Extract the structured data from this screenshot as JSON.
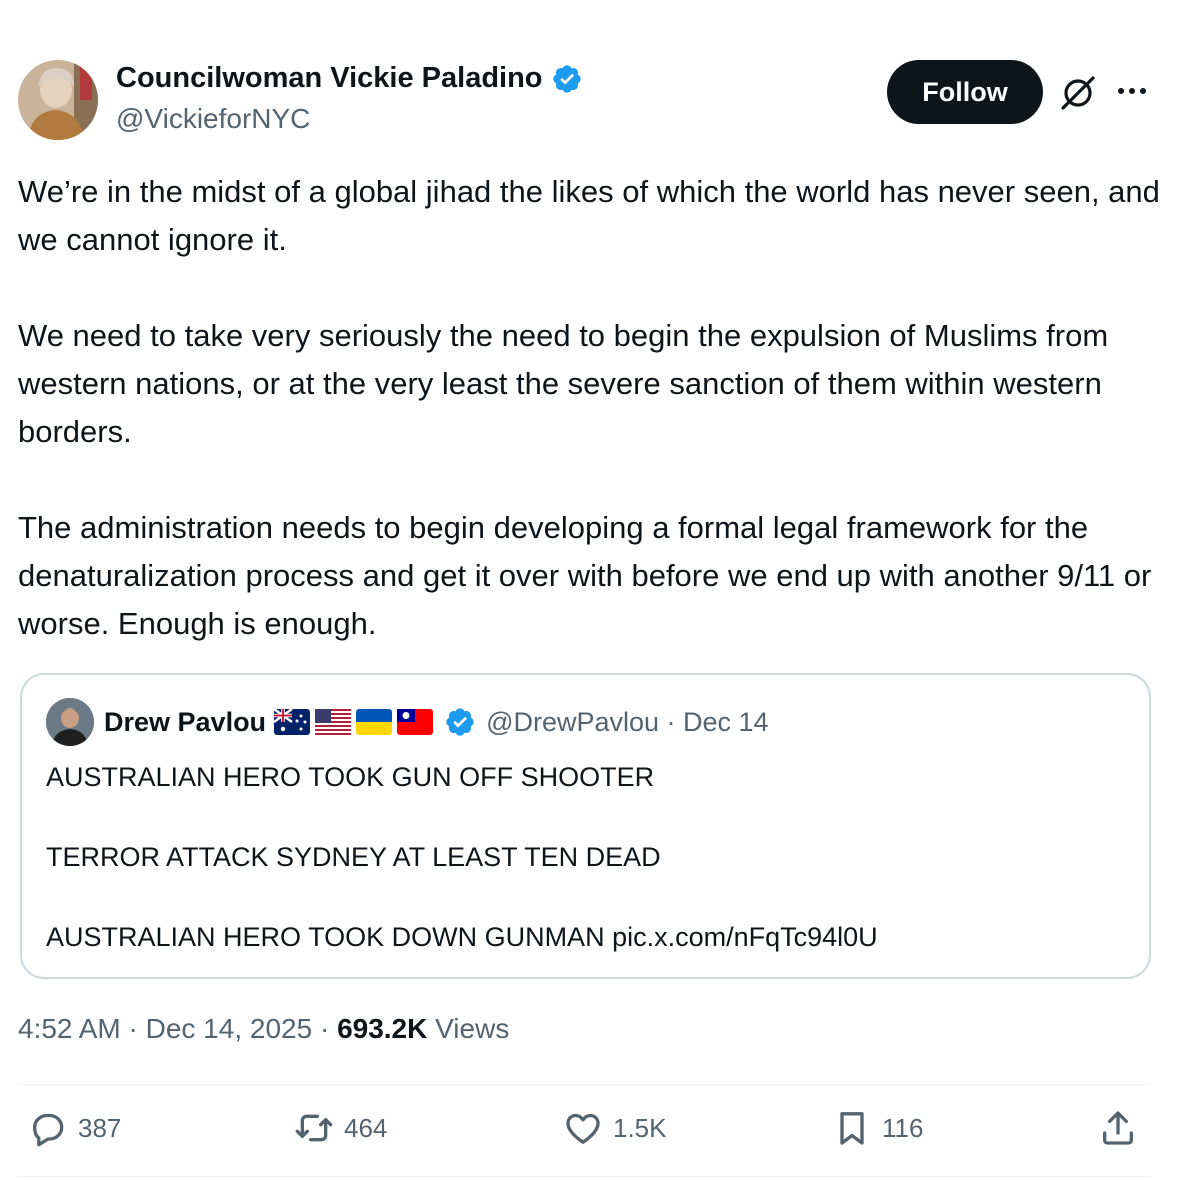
{
  "author": {
    "name": "Councilwoman Vickie Paladino",
    "handle": "@VickieforNYC"
  },
  "header": {
    "follow_label": "Follow"
  },
  "post": {
    "paragraphs": [
      "We’re in the midst of a global jihad the likes of which the world has never seen, and we cannot ignore it.",
      "We need to take very seriously the need to begin the expulsion of Muslims from western nations, or at the very least the severe sanction of them within western borders.",
      "The administration needs to begin developing a formal legal framework for the denaturalization process and get it over with before we end up with another 9/11 or worse. Enough is enough."
    ]
  },
  "quote": {
    "name": "Drew Pavlou",
    "flags": [
      "australia-flag",
      "usa-flag",
      "ukraine-flag",
      "taiwan-flag"
    ],
    "handle_date": "@DrewPavlou · Dec 14",
    "lines": [
      "AUSTRALIAN HERO TOOK GUN OFF SHOOTER",
      "TERROR ATTACK SYDNEY AT LEAST TEN DEAD",
      "AUSTRALIAN HERO TOOK DOWN GUNMAN pic.x.com/nFqTc94l0U"
    ]
  },
  "meta": {
    "timestamp": "4:52 AM · Dec 14, 2025 · ",
    "views_count": "693.2K",
    "views_label": " Views"
  },
  "actions": {
    "replies": "387",
    "reposts": "464",
    "likes": "1.5K",
    "bookmarks": "116"
  },
  "colors": {
    "text_primary": "#0f1419",
    "text_secondary": "#536471",
    "verified_blue": "#1d9bf0",
    "border": "#cfd9de"
  },
  "icons": [
    "verified-badge-icon",
    "grok-icon",
    "more-icon",
    "reply-icon",
    "repost-icon",
    "like-icon",
    "bookmark-icon",
    "share-icon"
  ]
}
